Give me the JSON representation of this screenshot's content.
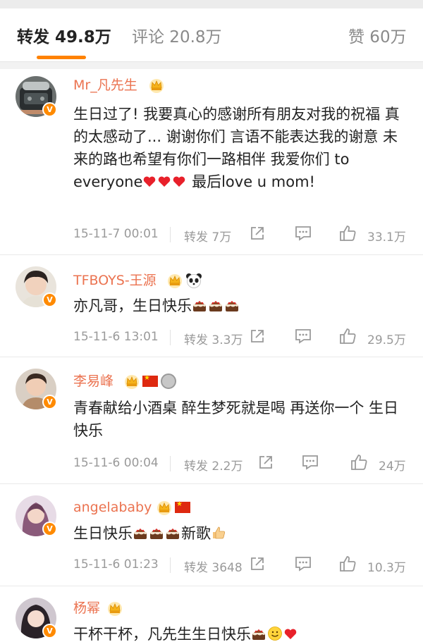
{
  "tabs": {
    "repost": "转发 49.8万",
    "comment": "评论 20.8万",
    "like": "赞 60万"
  },
  "comments": [
    {
      "name": "Mr_凡先生",
      "text": "生日过了! 我要真心的感谢所有朋友对我的祝福 真的太感动了... 谢谢你们 言语不能表达我的谢意 未来的路也希望有你们一路相伴 我爱你们 to everyone",
      "text_after": " 最后love u mom!",
      "time": "15-11-7 00:01",
      "repost": "转发 7万",
      "likes": "33.1万"
    },
    {
      "name": "TFBOYS-王源",
      "text": "亦凡哥，生日快乐",
      "time": "15-11-6 13:01",
      "repost": "转发 3.3万",
      "likes": "29.5万"
    },
    {
      "name": "李易峰",
      "text": "青春献给小酒桌 醉生梦死就是喝 再送你一个 生日快乐",
      "time": "15-11-6 00:04",
      "repost": "转发 2.2万",
      "likes": "24万"
    },
    {
      "name": "angelababy",
      "text": "生日快乐",
      "text_after": "新歌",
      "time": "15-11-6 01:23",
      "repost": "转发 3648",
      "likes": "10.3万"
    },
    {
      "name": "杨幂",
      "text": "干杯干杯，凡先生生日快乐"
    }
  ],
  "colors": {
    "accent": "#ff8200",
    "username": "#eb7350",
    "verified": "#ff8a00"
  },
  "icons": [
    "crown-icon",
    "verified-badge",
    "panda-emoji",
    "china-flag-icon",
    "medal-icon",
    "heart-emoji",
    "cake-emoji",
    "thumbs-up-emoji",
    "smile-emoji",
    "share-icon",
    "reply-icon",
    "like-icon"
  ]
}
